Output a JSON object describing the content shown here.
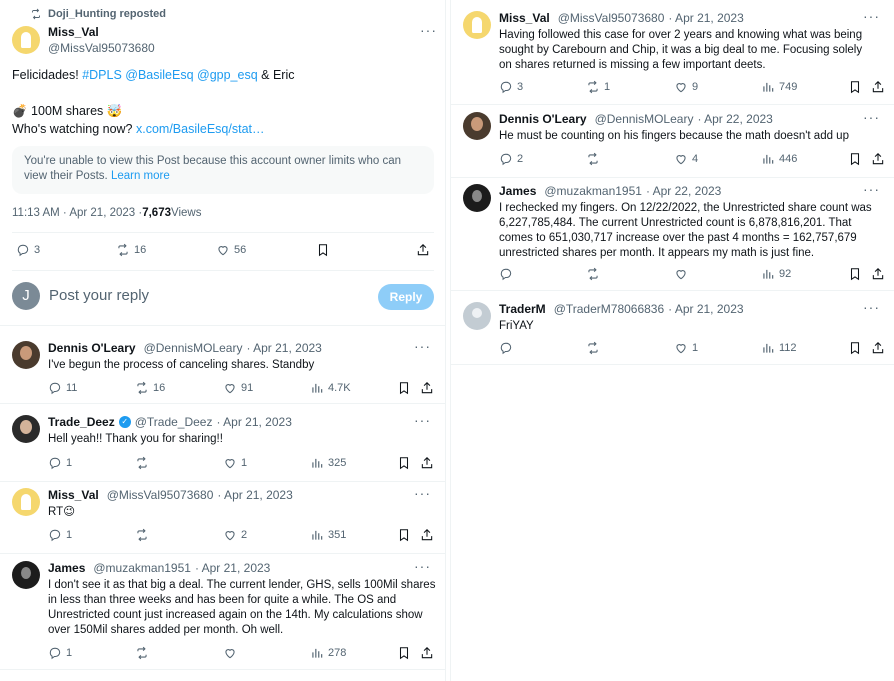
{
  "main_post": {
    "repost_label": "Doji_Hunting reposted",
    "name": "Miss_Val",
    "handle": "@MissVal95073680",
    "line1_prefix": "Felicidades! ",
    "line1_tags": "#DPLS @BasileEsq @gpp_esq",
    "line1_suffix": " & Eric",
    "line2": "💣 100M shares 🤯",
    "line3_prefix": "Who's watching now? ",
    "line3_link": "x.com/BasileEsq/stat…",
    "restricted_text": "You're unable to view this Post because this account owner limits who can view their Posts.",
    "restricted_link": "Learn more",
    "time": "11:13 AM · Apr 21, 2023 · ",
    "views_count": "7,673",
    "views_label": " Views",
    "replies": "3",
    "reposts": "16",
    "likes": "56"
  },
  "reply_box": {
    "avatar_letter": "J",
    "placeholder": "Post your reply",
    "button": "Reply"
  },
  "left_replies": [
    {
      "name": "Dennis O'Leary",
      "handle": "@DennisMOLeary",
      "date": "· Apr 21, 2023",
      "text": "I've begun the process of canceling shares. Standby",
      "replies": "11",
      "reposts": "16",
      "likes": "91",
      "views": "4.7K"
    },
    {
      "name": "Trade_Deez",
      "handle": "@Trade_Deez",
      "date": "· Apr 21, 2023",
      "text": "Hell yeah!!  Thank you for sharing!!",
      "replies": "1",
      "reposts": "",
      "likes": "1",
      "views": "325"
    },
    {
      "name": "Miss_Val",
      "handle": "@MissVal95073680",
      "date": "· Apr 21, 2023",
      "text": "RT😉",
      "replies": "1",
      "reposts": "",
      "likes": "2",
      "views": "351"
    },
    {
      "name": "James",
      "handle": "@muzakman1951",
      "date": "· Apr 21, 2023",
      "text": "I don't see it as that big a deal. The current lender, GHS, sells 100Mil shares in less than three weeks and has been for quite a while. The OS and Unrestricted count just increased again on the 14th. My calculations show over 150Mil shares added per month. Oh well.",
      "replies": "1",
      "reposts": "",
      "likes": "",
      "views": "278"
    }
  ],
  "right_replies": [
    {
      "name": "Miss_Val",
      "handle": "@MissVal95073680",
      "date": "· Apr 21, 2023",
      "text": "Having followed this case for over 2 years and knowing what was being sought by Carebourn and Chip, it was a big deal to me. Focusing solely on shares returned is missing a few important deets.",
      "replies": "3",
      "reposts": "1",
      "likes": "9",
      "views": "749"
    },
    {
      "name": "Dennis O'Leary",
      "handle": "@DennisMOLeary",
      "date": "· Apr 22, 2023",
      "text": "He must be counting on his fingers because the math doesn't add up",
      "replies": "2",
      "reposts": "",
      "likes": "4",
      "views": "446"
    },
    {
      "name": "James",
      "handle": "@muzakman1951",
      "date": "· Apr 22, 2023",
      "text": "I rechecked my fingers. On 12/22/2022, the Unrestricted share count was 6,227,785,484. The current Unrestricted count is 6,878,816,201. That comes to 651,030,717 increase over the past 4 months = 162,757,679 unrestricted shares per month. It appears my math is just fine.",
      "replies": "",
      "reposts": "",
      "likes": "",
      "views": "92"
    },
    {
      "name": "TraderM",
      "handle": "@TraderM78066836",
      "date": "· Apr 21, 2023",
      "text": "FriYAY",
      "replies": "",
      "reposts": "",
      "likes": "1",
      "views": "112"
    }
  ],
  "icons": {
    "reply": "speech-bubble-icon",
    "repost": "repost-arrows-icon",
    "like": "heart-icon",
    "views": "bar-chart-icon",
    "bookmark": "bookmark-icon",
    "share": "share-arrow-icon",
    "more": "more-dots-icon",
    "verified": "verified-badge-icon"
  },
  "colors": {
    "accent": "#1d9bf0",
    "muted": "#536471",
    "text": "#0f1419",
    "reply_button": "#8ecdf8"
  }
}
